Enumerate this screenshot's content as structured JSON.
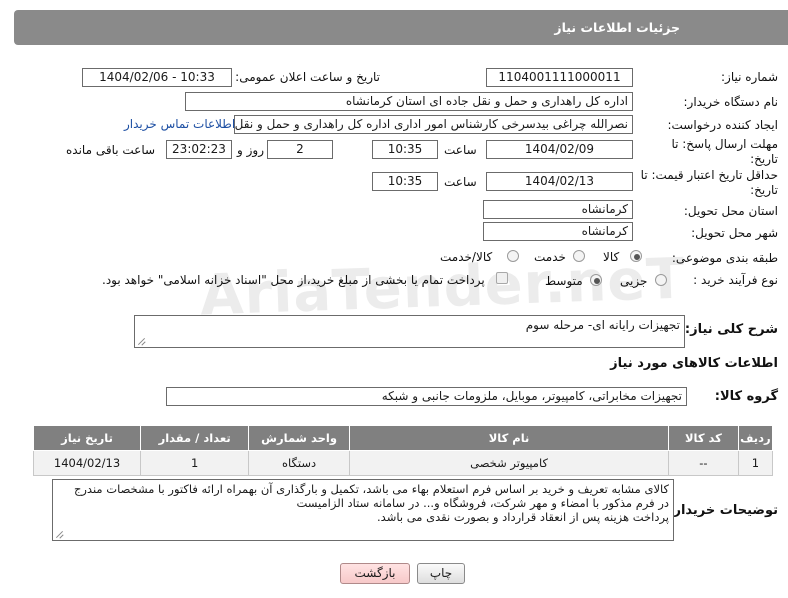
{
  "header": {
    "title": "جزئیات اطلاعات نیاز"
  },
  "fields": {
    "need_number_label": "شماره نیاز:",
    "need_number": "1104001111000011",
    "announce_label": "تاریخ و ساعت اعلان عمومی:",
    "announce_value": "1404/02/06 - 10:33",
    "buyer_org_label": "نام دستگاه خریدار:",
    "buyer_org": "اداره کل راهداری و حمل و نقل جاده ای استان کرمانشاه",
    "creator_label": "ایجاد کننده درخواست:",
    "creator": "نصرالله چراغی بیدسرخی کارشناس امور اداری اداره کل راهداری و حمل و نقل ج",
    "contact_link": "اطلاعات تماس خریدار",
    "reply_deadline_label": "مهلت ارسال پاسخ: تا تاریخ:",
    "reply_date": "1404/02/09",
    "time_label": "ساعت",
    "reply_time": "10:35",
    "days_value": "2",
    "days_label": "روز و",
    "remaining_time": "23:02:23",
    "remaining_label": "ساعت باقی مانده",
    "price_validity_label": "حداقل تاریخ اعتبار قیمت: تا تاریخ:",
    "price_date": "1404/02/13",
    "price_time": "10:35",
    "province_label": "استان محل تحویل:",
    "province": "کرمانشاه",
    "city_label": "شهر محل تحویل:",
    "city": "کرمانشاه",
    "category_label": "طبقه بندی موضوعی:",
    "category_options": [
      "کالا",
      "خدمت",
      "کالا/خدمت"
    ],
    "process_label": "نوع فرآیند خرید :",
    "process_options": [
      "جزیی",
      "متوسط"
    ],
    "payment_note": "پرداخت تمام یا بخشی از مبلغ خرید،از محل \"اسناد خزانه اسلامی\" خواهد بود."
  },
  "general_desc": {
    "label": "شرح کلی نیاز:",
    "value": "تجهیزات رایانه ای- مرحله سوم"
  },
  "goods_info": {
    "title": "اطلاعات کالاهای مورد نیاز",
    "group_label": "گروه کالا:",
    "group_value": "تجهیزات مخابراتی، کامپیوتر، موبایل، ملزومات جانبی و شبکه"
  },
  "table": {
    "headers": [
      "ردیف",
      "کد کالا",
      "نام کالا",
      "واحد شمارش",
      "تعداد / مقدار",
      "تاریخ نیاز"
    ],
    "rows": [
      [
        "1",
        "--",
        "کامپیوتر شخصی",
        "دستگاه",
        "1",
        "1404/02/13"
      ]
    ]
  },
  "buyer_notes": {
    "label": "توضیحات خریدار:",
    "line1": "کالای مشابه تعریف و خرید بر اساس فرم استعلام بهاء می باشد، تکمیل و بارگذاری آن بهمراه ارائه فاکتور با مشخصات مندرج",
    "line2": "در فرم مذکور با امضاء و مهر شرکت، فروشگاه و... در سامانه ستاد الزامیست",
    "line3": "پرداخت هزینه پس از انعقاد قرارداد و بصورت نقدی می باشد."
  },
  "buttons": {
    "print": "چاپ",
    "back": "بازگشت"
  },
  "watermark": "AriaTender.neT"
}
